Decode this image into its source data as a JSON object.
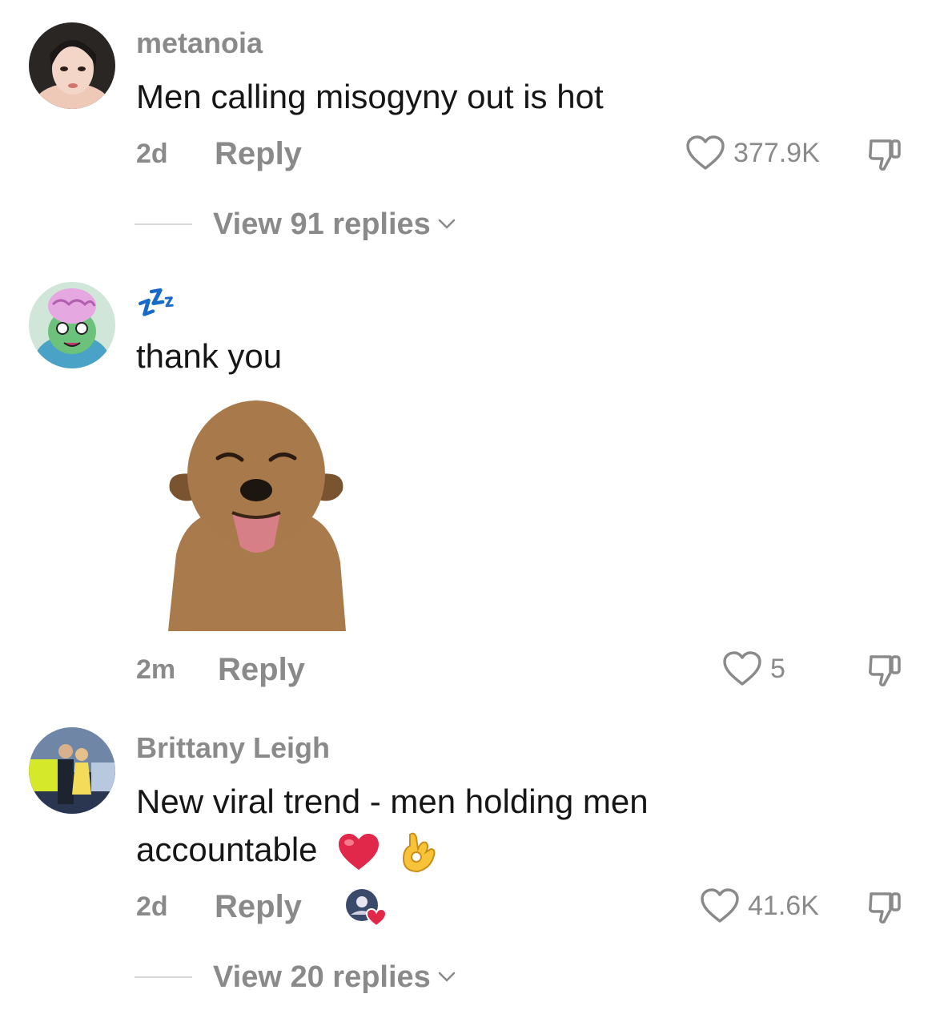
{
  "comments": [
    {
      "username": "metanoia",
      "text": "Men calling misogyny out is hot",
      "age": "2d",
      "reply_label": "Reply",
      "likes": "377.9K",
      "view_replies": "View 91 replies"
    },
    {
      "username_emoji": "💤",
      "text": "thank you",
      "age": "2m",
      "reply_label": "Reply",
      "likes": "5"
    },
    {
      "username": "Brittany Leigh",
      "text_line1": "New viral trend - men holding men",
      "text_line2": "accountable",
      "text_emojis": [
        "red-heart",
        "ok-hand"
      ],
      "age": "2d",
      "reply_label": "Reply",
      "likes": "41.6K",
      "view_replies": "View 20 replies",
      "creator_liked": true
    }
  ],
  "colors": {
    "primary_text": "#161616",
    "secondary_text": "#8a8a8a",
    "heart_red": "#e2284a"
  }
}
